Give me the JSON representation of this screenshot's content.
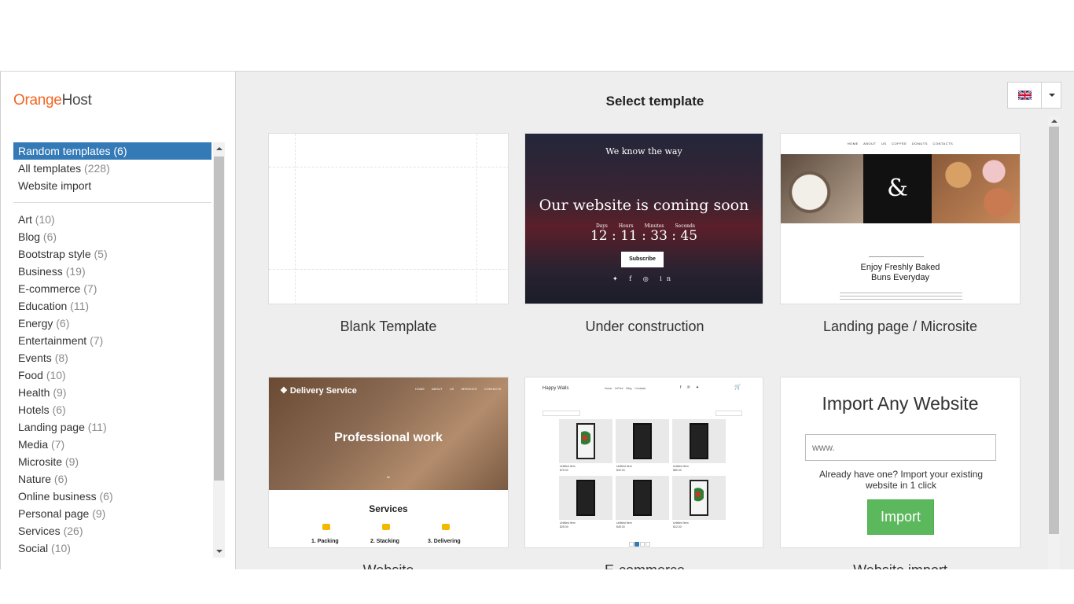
{
  "brand": {
    "logo_orange": "Orange",
    "logo_rest": "Host"
  },
  "sidebar": {
    "top_items": [
      {
        "label": "Random templates (6)",
        "active": true
      },
      {
        "label": "All templates",
        "count": "(228)"
      },
      {
        "label": "Website import"
      }
    ],
    "categories": [
      {
        "label": "Art",
        "count": "(10)"
      },
      {
        "label": "Blog",
        "count": "(6)"
      },
      {
        "label": "Bootstrap style",
        "count": "(5)"
      },
      {
        "label": "Business",
        "count": "(19)"
      },
      {
        "label": "E-commerce",
        "count": "(7)"
      },
      {
        "label": "Education",
        "count": "(11)"
      },
      {
        "label": "Energy",
        "count": "(6)"
      },
      {
        "label": "Entertainment",
        "count": "(7)"
      },
      {
        "label": "Events",
        "count": "(8)"
      },
      {
        "label": "Food",
        "count": "(10)"
      },
      {
        "label": "Health",
        "count": "(9)"
      },
      {
        "label": "Hotels",
        "count": "(6)"
      },
      {
        "label": "Landing page",
        "count": "(11)"
      },
      {
        "label": "Media",
        "count": "(7)"
      },
      {
        "label": "Microsite",
        "count": "(9)"
      },
      {
        "label": "Nature",
        "count": "(6)"
      },
      {
        "label": "Online business",
        "count": "(6)"
      },
      {
        "label": "Personal page",
        "count": "(9)"
      },
      {
        "label": "Services",
        "count": "(26)"
      },
      {
        "label": "Social",
        "count": "(10)"
      }
    ]
  },
  "main": {
    "title": "Select template",
    "language_icon": "uk-flag-icon"
  },
  "templates": [
    {
      "label": "Blank Template"
    },
    {
      "label": "Under construction",
      "preview": {
        "subtitle": "We know the way",
        "heading": "Our website is coming soon",
        "countdown_labels": [
          "Days",
          "Hours",
          "Minutes",
          "Seconds"
        ],
        "countdown": "12 : 11 : 33 : 45",
        "button": "Subscribe",
        "social": "✦ f ◎ in"
      }
    },
    {
      "label": "Landing page / Microsite",
      "preview": {
        "nav": "HOME ABOUT US COFFEE DONUTS CONTACTS",
        "amp": "&",
        "heading_line1": "Enjoy Freshly Baked",
        "heading_line2": "Buns Everyday"
      }
    },
    {
      "label": "Website",
      "preview": {
        "brand": "❖ Delivery Service",
        "nav": "HOME ABOUT US SERVICES CONTACTS",
        "hero": "Professional work",
        "chevron": "⌄",
        "services_title": "Services",
        "services": [
          "1. Packing",
          "2. Stacking",
          "3. Delivering"
        ]
      }
    },
    {
      "label": "E-commerce",
      "preview": {
        "brand": "Happy Walls",
        "nav": "Home InPrint Blog Contacts",
        "social": "f ℗ ✦",
        "cart": "⚙",
        "products": [
          {
            "name": "Untitled Item",
            "price": "$75.00"
          },
          {
            "name": "Untitled Item",
            "price": "$32.00"
          },
          {
            "name": "Untitled Item",
            "price": "$80.00"
          },
          {
            "name": "Untitled Item",
            "price": "$25.00"
          },
          {
            "name": "Untitled Item",
            "price": "$45.00"
          },
          {
            "name": "Untitled Item",
            "price": "$12.00"
          }
        ]
      }
    },
    {
      "label": "Website import",
      "preview": {
        "heading": "Import Any Website",
        "input_placeholder": "www.",
        "text": "Already have one? Import your existing website in 1 click",
        "button": "Import"
      }
    }
  ],
  "colors": {
    "accent": "#337ab7",
    "brand_orange": "#f26522",
    "import_green": "#5cb85c"
  }
}
